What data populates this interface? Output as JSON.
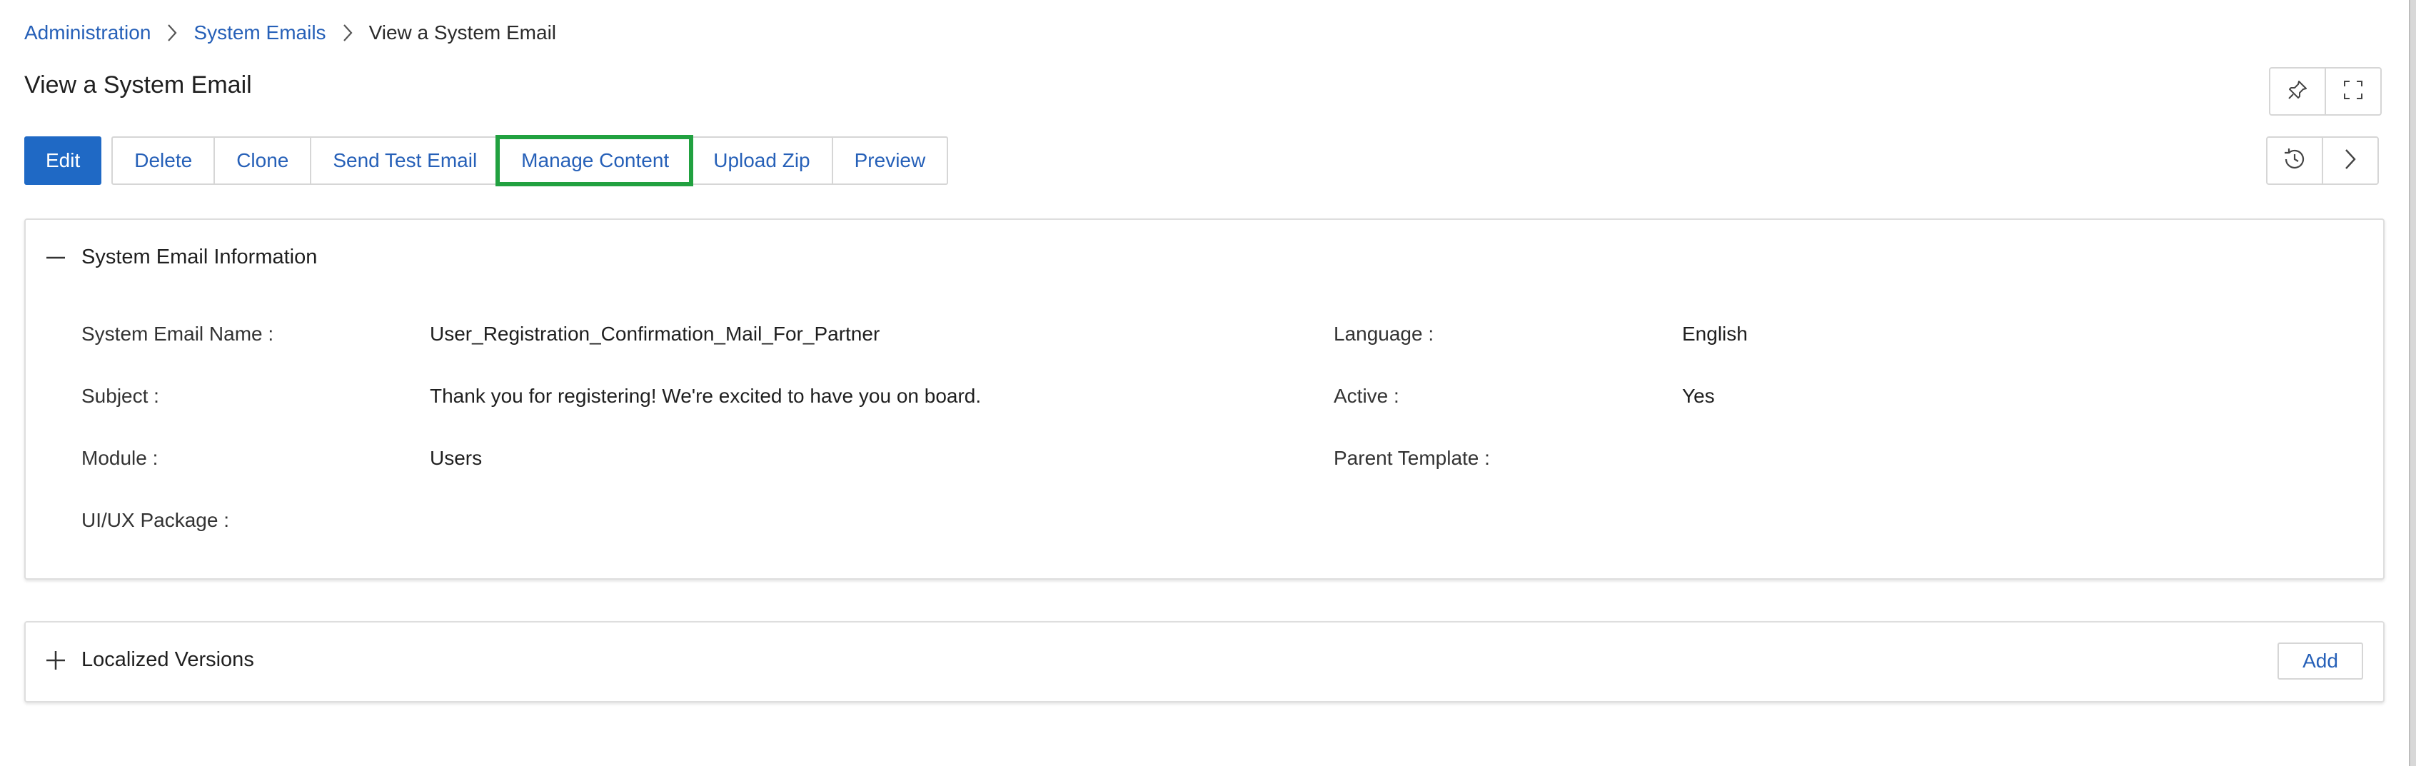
{
  "breadcrumb": [
    {
      "label": "Administration"
    },
    {
      "label": "System Emails"
    },
    {
      "label": "View a System Email"
    }
  ],
  "page": {
    "title": "View a System Email"
  },
  "toolbar": {
    "edit": "Edit",
    "delete": "Delete",
    "clone": "Clone",
    "send_test_email": "Send Test Email",
    "manage_content": "Manage Content",
    "upload_zip": "Upload Zip",
    "preview": "Preview"
  },
  "icons": {
    "pin": "pin-icon",
    "fullscreen": "fullscreen-icon",
    "history": "history-icon",
    "next": "chevron-right-icon"
  },
  "info_panel": {
    "title": "System Email Information",
    "fields": {
      "name": {
        "label": "System Email Name :",
        "value": "User_Registration_Confirmation_Mail_For_Partner"
      },
      "subject": {
        "label": "Subject :",
        "value": "Thank you for registering! We're excited to have you on board."
      },
      "module": {
        "label": "Module :",
        "value": "Users"
      },
      "uiux": {
        "label": "UI/UX Package :",
        "value": ""
      },
      "language": {
        "label": "Language :",
        "value": "English"
      },
      "active": {
        "label": "Active :",
        "value": "Yes"
      },
      "parent": {
        "label": "Parent Template :",
        "value": ""
      }
    }
  },
  "localized_panel": {
    "title": "Localized Versions",
    "add_label": "Add"
  },
  "colors": {
    "accent": "#1f69c5",
    "link": "#2660b8",
    "highlight": "#21a140"
  }
}
